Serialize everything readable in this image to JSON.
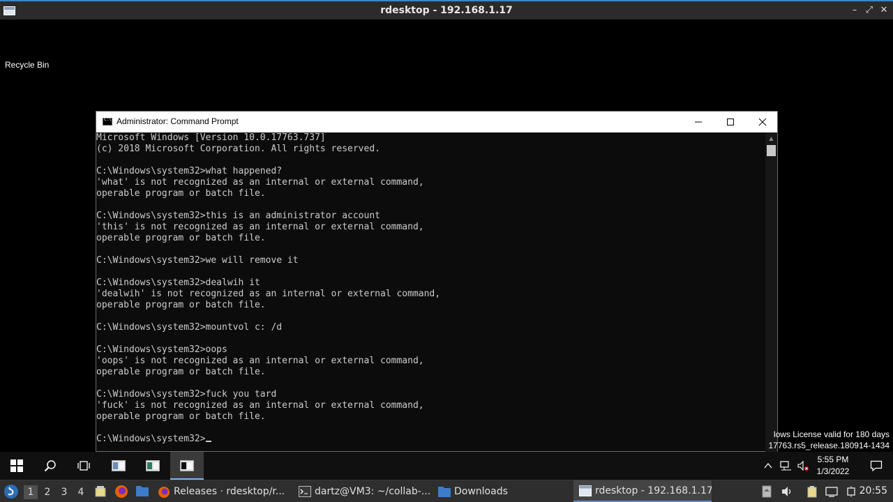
{
  "outer_window": {
    "title": "rdesktop - 192.168.1.17",
    "controls": [
      "minimize-icon",
      "restore-icon",
      "close-icon"
    ]
  },
  "desktop": {
    "recycle_bin_label": "Recycle Bin"
  },
  "cmd_window": {
    "title": "Administrator: Command Prompt",
    "lines": [
      "Microsoft Windows [Version 10.0.17763.737]",
      "(c) 2018 Microsoft Corporation. All rights reserved.",
      "",
      "C:\\Windows\\system32>what happened?",
      "'what' is not recognized as an internal or external command,",
      "operable program or batch file.",
      "",
      "C:\\Windows\\system32>this is an administrator account",
      "'this' is not recognized as an internal or external command,",
      "operable program or batch file.",
      "",
      "C:\\Windows\\system32>we will remove it",
      "",
      "C:\\Windows\\system32>dealwih it",
      "'dealwih' is not recognized as an internal or external command,",
      "operable program or batch file.",
      "",
      "C:\\Windows\\system32>mountvol c: /d",
      "",
      "C:\\Windows\\system32>oops",
      "'oops' is not recognized as an internal or external command,",
      "operable program or batch file.",
      "",
      "C:\\Windows\\system32>fuck you tard",
      "'fuck' is not recognized as an internal or external command,",
      "operable program or batch file.",
      "",
      "C:\\Windows\\system32>"
    ]
  },
  "watermark": {
    "line1": "lows License valid for 180 days",
    "line2": "17763.rs5_release.180914-1434"
  },
  "windows_taskbar": {
    "pinned": [
      "start-icon",
      "search-icon",
      "task-view-icon",
      "app-icon",
      "app-icon",
      "command-prompt-icon"
    ],
    "clock_time": "5:55 PM",
    "clock_date": "1/3/2022"
  },
  "linux_panel": {
    "workspaces": [
      "1",
      "2",
      "3",
      "4"
    ],
    "tasks": [
      {
        "label": "Releases · rdesktop/r...",
        "icon": "firefox-icon"
      },
      {
        "label": "dartz@VM3: ~/collab-...",
        "icon": "terminal-icon"
      },
      {
        "label": "Downloads",
        "icon": "folder-icon"
      },
      {
        "label": "rdesktop - 192.168.1.17",
        "icon": "window-icon"
      }
    ],
    "time": "20:55"
  }
}
